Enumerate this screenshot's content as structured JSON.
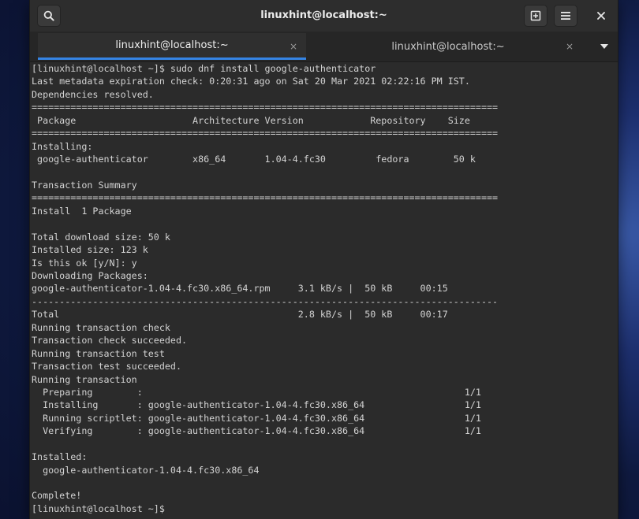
{
  "window": {
    "title": "linuxhint@localhost:~",
    "icons": {
      "search": "search-icon",
      "new_tab": "new-tab-icon",
      "menu": "hamburger-menu-icon",
      "close": "close-icon",
      "tab_close": "close-icon",
      "tab_menu": "chevron-down-icon"
    }
  },
  "tabs": [
    {
      "label": "linuxhint@localhost:~",
      "active": true,
      "close": "×"
    },
    {
      "label": "linuxhint@localhost:~",
      "active": false,
      "close": "×"
    }
  ],
  "colors": {
    "accent": "#3584e4",
    "terminal_bg": "#2b2b2b",
    "terminal_fg": "#d3d3d3"
  },
  "terminal": {
    "lines": [
      "[linuxhint@localhost ~]$ sudo dnf install google-authenticator",
      "Last metadata expiration check: 0:20:31 ago on Sat 20 Mar 2021 02:22:16 PM IST.",
      "Dependencies resolved.",
      "====================================================================================",
      " Package                     Architecture Version            Repository    Size",
      "====================================================================================",
      "Installing:",
      " google-authenticator        x86_64       1.04-4.fc30         fedora        50 k",
      "",
      "Transaction Summary",
      "====================================================================================",
      "Install  1 Package",
      "",
      "Total download size: 50 k",
      "Installed size: 123 k",
      "Is this ok [y/N]: y",
      "Downloading Packages:",
      "google-authenticator-1.04-4.fc30.x86_64.rpm     3.1 kB/s |  50 kB     00:15",
      "------------------------------------------------------------------------------------",
      "Total                                           2.8 kB/s |  50 kB     00:17",
      "Running transaction check",
      "Transaction check succeeded.",
      "Running transaction test",
      "Transaction test succeeded.",
      "Running transaction",
      "  Preparing        :                                                          1/1",
      "  Installing       : google-authenticator-1.04-4.fc30.x86_64                  1/1",
      "  Running scriptlet: google-authenticator-1.04-4.fc30.x86_64                  1/1",
      "  Verifying        : google-authenticator-1.04-4.fc30.x86_64                  1/1",
      "",
      "Installed:",
      "  google-authenticator-1.04-4.fc30.x86_64",
      "",
      "Complete!",
      "[linuxhint@localhost ~]$ "
    ]
  }
}
